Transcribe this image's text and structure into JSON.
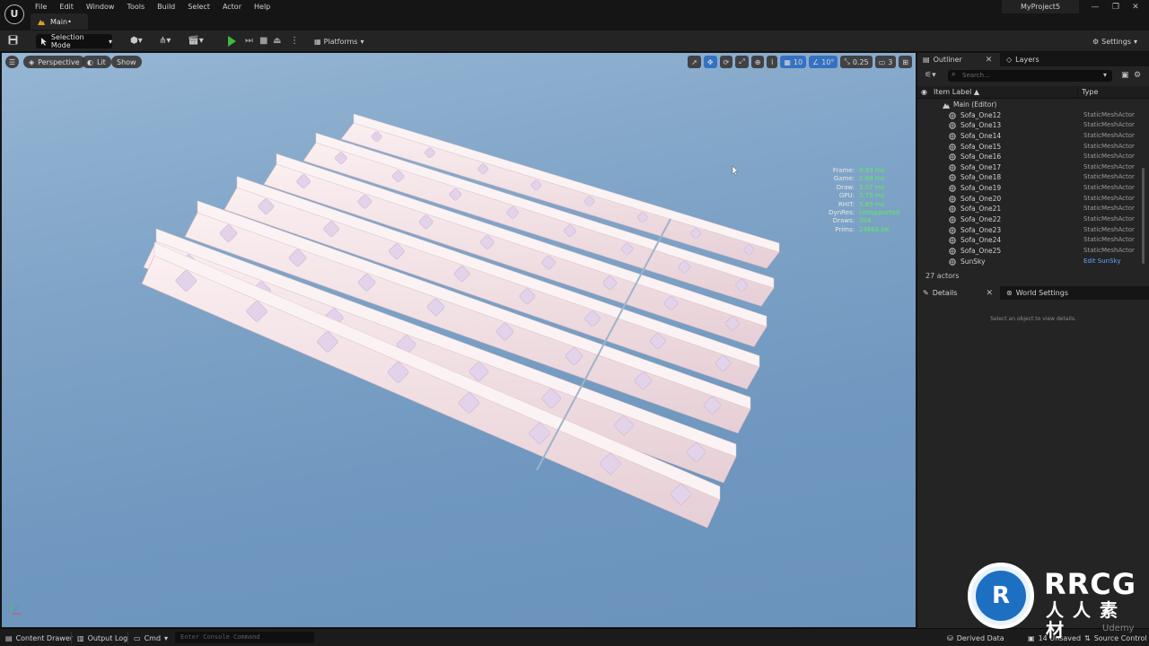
{
  "app": {
    "menu": [
      "File",
      "Edit",
      "Window",
      "Tools",
      "Build",
      "Select",
      "Actor",
      "Help"
    ],
    "level_tab": "Main•",
    "project_name": "MyProject5",
    "window_controls": [
      "—",
      "❐",
      "✕"
    ]
  },
  "toolbar": {
    "selection_mode": "Selection Mode",
    "platforms": "Platforms",
    "settings": "Settings"
  },
  "viewport": {
    "perspective": "Perspective",
    "lit": "Lit",
    "show": "Show",
    "grid_snap": "10",
    "rotation_snap": "10°",
    "scale_snap": "0.25",
    "camera_speed": "3",
    "stats": [
      {
        "key": "Frame:",
        "value": "8.33 ms"
      },
      {
        "key": "Game:",
        "value": "2.98 ms"
      },
      {
        "key": "Draw:",
        "value": "3.07 ms"
      },
      {
        "key": "GPU:",
        "value": "5.75 ms"
      },
      {
        "key": "RHIT:",
        "value": "5.85 ms"
      },
      {
        "key": "DynRes:",
        "value": "Unsupported"
      },
      {
        "key": "Draws:",
        "value": "304"
      },
      {
        "key": "Prims:",
        "value": "24666.0K"
      }
    ]
  },
  "outliner": {
    "tab": "Outliner",
    "layers_tab": "Layers",
    "search_placeholder": "Search...",
    "col_label": "Item Label ▲",
    "col_type": "Type",
    "folder": "Main (Editor)",
    "items": [
      {
        "name": "Sofa_One12",
        "type": "StaticMeshActor"
      },
      {
        "name": "Sofa_One13",
        "type": "StaticMeshActor"
      },
      {
        "name": "Sofa_One14",
        "type": "StaticMeshActor"
      },
      {
        "name": "Sofa_One15",
        "type": "StaticMeshActor"
      },
      {
        "name": "Sofa_One16",
        "type": "StaticMeshActor"
      },
      {
        "name": "Sofa_One17",
        "type": "StaticMeshActor"
      },
      {
        "name": "Sofa_One18",
        "type": "StaticMeshActor"
      },
      {
        "name": "Sofa_One19",
        "type": "StaticMeshActor"
      },
      {
        "name": "Sofa_One20",
        "type": "StaticMeshActor"
      },
      {
        "name": "Sofa_One21",
        "type": "StaticMeshActor"
      },
      {
        "name": "Sofa_One22",
        "type": "StaticMeshActor"
      },
      {
        "name": "Sofa_One23",
        "type": "StaticMeshActor"
      },
      {
        "name": "Sofa_One24",
        "type": "StaticMeshActor"
      },
      {
        "name": "Sofa_One25",
        "type": "StaticMeshActor"
      },
      {
        "name": "SunSky",
        "type": "Edit SunSky"
      }
    ],
    "actor_count": "27 actors"
  },
  "details": {
    "tab": "Details",
    "world_settings_tab": "World Settings",
    "hint": "Select an object to view details."
  },
  "statusbar": {
    "content_drawer": "Content Drawer",
    "output_log": "Output Log",
    "cmd": "Cmd",
    "console_placeholder": "Enter Console Command",
    "derived_data": "Derived Data",
    "unsaved": "14 Unsaved",
    "source_control": "Source Control"
  },
  "watermark": {
    "brand": "RRCG",
    "sub": "人人素材",
    "udemy": "Udemy"
  }
}
